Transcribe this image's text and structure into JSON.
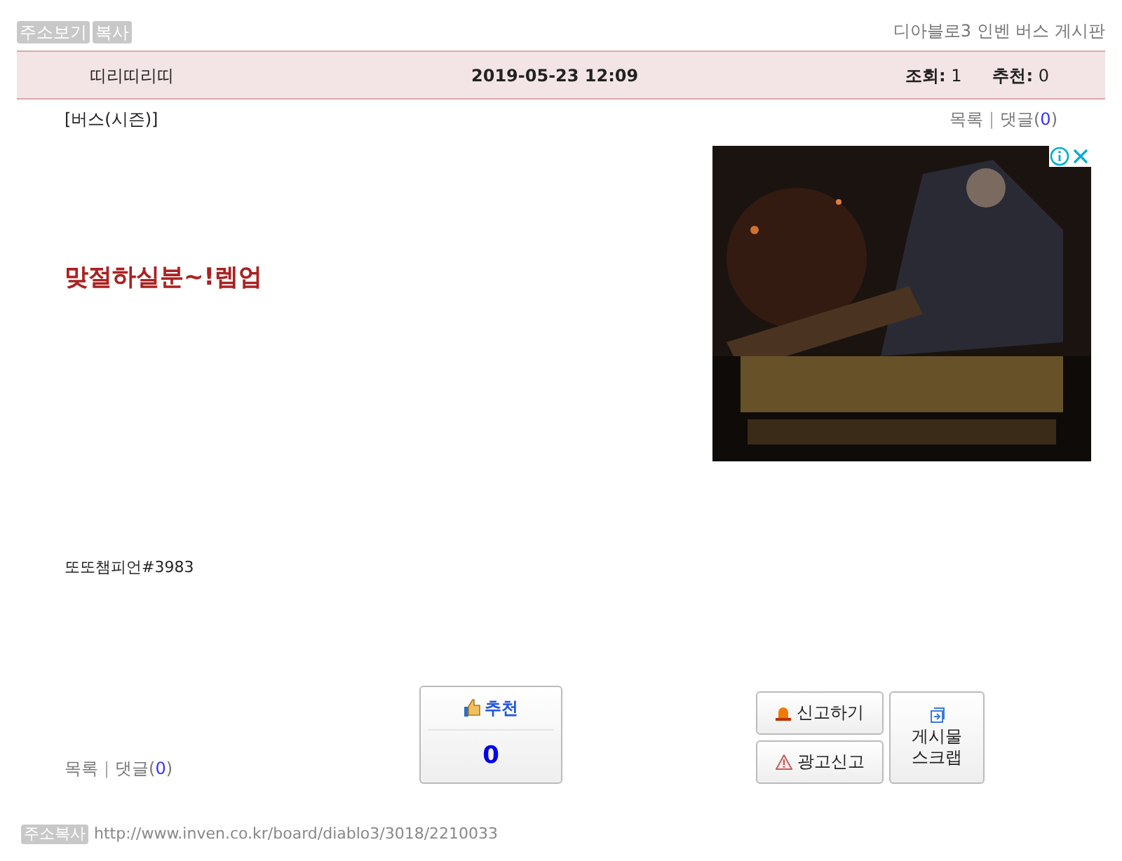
{
  "top_buttons": [
    "주소보기",
    "복사"
  ],
  "board_title": "디아블로3 인벤 버스 게시판",
  "header": {
    "author": "띠리띠리띠",
    "date": "2019-05-23 12:09",
    "views_label": "조회:",
    "views": "1",
    "recommend_label": "추천:",
    "recommend": "0"
  },
  "category": "[버스(시즌)]",
  "links_top": {
    "list": "목록",
    "separator": "|",
    "comments": "댓글(",
    "count": "0",
    "close": ")"
  },
  "title": "맞절하실분~!렙업",
  "body": "또또챔피언#3983",
  "recommend_button": {
    "label": "추천",
    "count": "0"
  },
  "report_buttons": [
    "신고하기",
    "광고신고"
  ],
  "scrap_button": [
    "게시물",
    "스크랩"
  ],
  "links_bottom": {
    "list": "목록",
    "separator": "|",
    "comments": "댓글(",
    "count": "0",
    "close": ")"
  },
  "footer": {
    "button": "주소복사",
    "url": "http://www.inven.co.kr/board/diablo3/3018/2210033"
  }
}
